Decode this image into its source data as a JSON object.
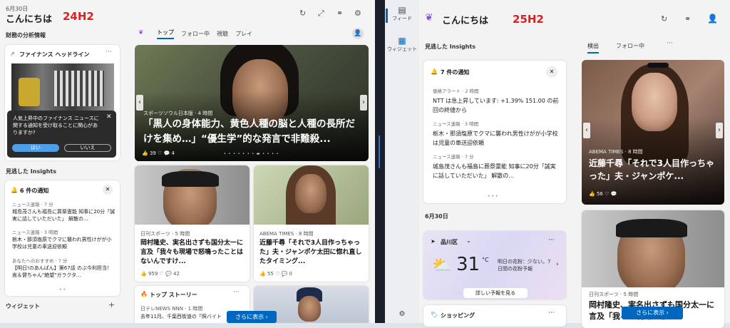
{
  "left": {
    "date": "6月30日",
    "greeting": "こんにちは",
    "tag": "24H2",
    "finance_section": "財務の分析情報",
    "finance_card_title": "ファイナンス ヘッドライン",
    "popup_text": "人気上昇中のファイナンス ニュースに関する通知を受け取ることに関心がありますか?",
    "popup_yes": "はい",
    "popup_no": "いいえ",
    "insights_section": "見逃した Insights",
    "notif_title": "6 件の通知",
    "notifs": [
      {
        "src": "ニュース速報 · 7 分",
        "text": "城島茂さんも福島に葬祭霊能 知事に20分「誠実に話していただいた」 解散の..."
      },
      {
        "src": "ニュース速報 · 3 時間",
        "text": "栃木・那須塩原でクマに襲われ男性けがが小学校は児童の車送迎依頼"
      },
      {
        "src": "あなたへのおすすめ · 7 分",
        "text": "【明日!のあんぱん】第67話 のぶ今利担当！嵩＆健ちゃん\"絶望\"ガラクタ..."
      }
    ],
    "widget_section": "ウィジェット",
    "tabs": [
      "トップ",
      "フォロー中",
      "視聴",
      "プレイ"
    ],
    "hero_source": "スポーツソウル日本版 · 4 時間",
    "hero_title": "「黒人の身体能力、黄色人種の脳と人種の長所だけを集め…」“優生学”的な発言で非難殺...",
    "hero_likes": "39",
    "hero_comments": "4",
    "card1_source": "日刊スポーツ · 5 時間",
    "card1_title": "岡村隆史、実名出さずも国分太一に言及「我々も現場で怒鳴ったことはないんですけ...",
    "card1_likes": "959",
    "card1_comments": "42",
    "card2_source": "ABEMA TIMES · 8 時間",
    "card2_title": "近藤千尋「それで3人目作っちゃった」夫・ジャンポケ太田に惚れ直したタイミング...",
    "card2_likes": "55",
    "card2_comments": "0",
    "top_stories": "トップ ストーリー",
    "top_src": "日テレNEWS NNN · 1 時間",
    "top_text": "去年11月、千葉西街道の「照バイト",
    "more_button": "さらに表示"
  },
  "right": {
    "greeting": "こんにちは",
    "tag": "25H2",
    "rail_feed": "フィード",
    "rail_widget": "ウィジェット",
    "insights_section": "見逃した Insights",
    "notif_title": "7 件の通知",
    "notifs": [
      {
        "src": "価格アラート · 2 時間",
        "text": "NTT は急上昇しています: +1.39% 151.00 の前回の終値から"
      },
      {
        "src": "ニュース速報 · 3 時間",
        "text": "栃木・那須塩原でクマに襲われ男性けがが小学校は児童の車送迎依頼"
      },
      {
        "src": "ニュース速報 · 7 分",
        "text": "城島茂さんも福島に葬祭霊能 知事に20分「誠実に話していただいた」 解散の..."
      }
    ],
    "date": "6月30日",
    "location": "品川区",
    "temp": "31",
    "unit": "°C",
    "pollen": "明日の花粉：少ない。7日間の花粉予報",
    "forecast_button": "詳しい予報を見る",
    "shopping": "ショッピング",
    "tabs": [
      "検出",
      "フォロー中"
    ],
    "hero_source": "ABEMA TIMES · 8 時間",
    "hero_title": "近藤千尋「それで3人目作っちゃった」夫・ジャンポケ...",
    "hero_likes": "56",
    "card_source": "日刊スポーツ · 5 時間",
    "card_title": "岡村隆史、実名出さずも国分太一に言及「我々も現場で怒",
    "more_button": "さらに表示"
  }
}
